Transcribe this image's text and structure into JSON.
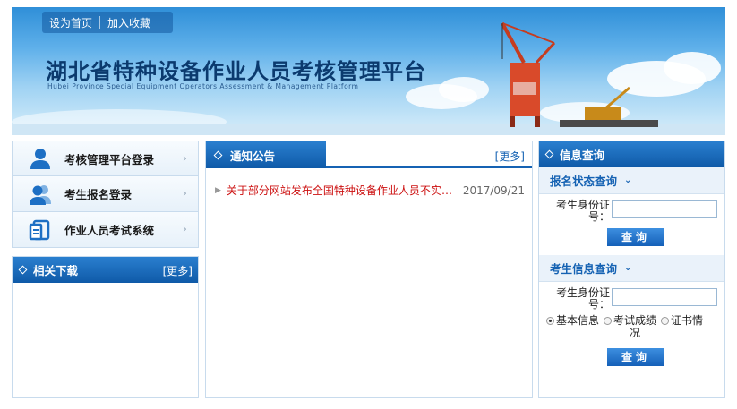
{
  "header": {
    "links": [
      "设为首页",
      "加入收藏"
    ],
    "title": "湖北省特种设备作业人员考核管理平台",
    "subtitle": "Hubei Province Special Equipment Operators Assessment & Management Platform"
  },
  "left_nav": {
    "items": [
      {
        "label": "考核管理平台登录",
        "icon": "single-user-icon"
      },
      {
        "label": "考生报名登录",
        "icon": "group-users-icon"
      },
      {
        "label": "作业人员考试系统",
        "icon": "document-icon"
      }
    ]
  },
  "downloads": {
    "title": "相关下载",
    "more": "[更多]"
  },
  "notice": {
    "title": "通知公告",
    "more": "[更多]",
    "items": [
      {
        "text": "关于部分网站发布全国特种设备作业人员不实信息...",
        "date": "2017/09/21"
      }
    ]
  },
  "info": {
    "title": "信息查询",
    "status_section": {
      "title": "报名状态查询",
      "id_label_1": "考生身份证",
      "id_label_2": "号：",
      "button": "查询"
    },
    "student_section": {
      "title": "考生信息查询",
      "id_label_1": "考生身份证",
      "id_label_2": "号：",
      "radios": [
        {
          "label_1": "基本信息",
          "label_2": "",
          "selected": true
        },
        {
          "label_1": "考试成绩",
          "label_2": "况",
          "selected": false
        },
        {
          "label_1": "证书情",
          "label_2": "",
          "selected": false
        }
      ],
      "button": "查询"
    }
  },
  "colors": {
    "accent": "#1562b3",
    "notice_text": "#cc1010"
  }
}
